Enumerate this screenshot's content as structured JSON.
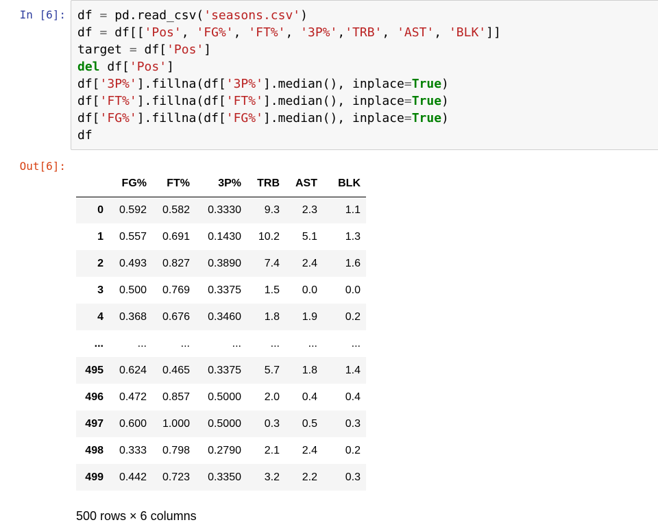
{
  "cell": {
    "in_prompt": "In [6]:",
    "out_prompt": "Out[6]:",
    "code_lines": [
      [
        {
          "t": "df "
        },
        {
          "t": "=",
          "c": "o"
        },
        {
          "t": " pd.read_csv("
        },
        {
          "t": "'seasons.csv'",
          "c": "s"
        },
        {
          "t": ")"
        }
      ],
      [
        {
          "t": "df "
        },
        {
          "t": "=",
          "c": "o"
        },
        {
          "t": " df[["
        },
        {
          "t": "'Pos'",
          "c": "s"
        },
        {
          "t": ", "
        },
        {
          "t": "'FG%'",
          "c": "s"
        },
        {
          "t": ", "
        },
        {
          "t": "'FT%'",
          "c": "s"
        },
        {
          "t": ", "
        },
        {
          "t": "'3P%'",
          "c": "s"
        },
        {
          "t": ","
        },
        {
          "t": "'TRB'",
          "c": "s"
        },
        {
          "t": ", "
        },
        {
          "t": "'AST'",
          "c": "s"
        },
        {
          "t": ", "
        },
        {
          "t": "'BLK'",
          "c": "s"
        },
        {
          "t": "]]"
        }
      ],
      [
        {
          "t": "target "
        },
        {
          "t": "=",
          "c": "o"
        },
        {
          "t": " df["
        },
        {
          "t": "'Pos'",
          "c": "s"
        },
        {
          "t": "]"
        }
      ],
      [
        {
          "t": "del",
          "c": "k"
        },
        {
          "t": " df["
        },
        {
          "t": "'Pos'",
          "c": "s"
        },
        {
          "t": "]"
        }
      ],
      [
        {
          "t": "df["
        },
        {
          "t": "'3P%'",
          "c": "s"
        },
        {
          "t": "].fillna(df["
        },
        {
          "t": "'3P%'",
          "c": "s"
        },
        {
          "t": "].median(), inplace"
        },
        {
          "t": "=",
          "c": "o"
        },
        {
          "t": "True",
          "c": "k"
        },
        {
          "t": ")"
        }
      ],
      [
        {
          "t": "df["
        },
        {
          "t": "'FT%'",
          "c": "s"
        },
        {
          "t": "].fillna(df["
        },
        {
          "t": "'FT%'",
          "c": "s"
        },
        {
          "t": "].median(), inplace"
        },
        {
          "t": "=",
          "c": "o"
        },
        {
          "t": "True",
          "c": "k"
        },
        {
          "t": ")"
        }
      ],
      [
        {
          "t": "df["
        },
        {
          "t": "'FG%'",
          "c": "s"
        },
        {
          "t": "].fillna(df["
        },
        {
          "t": "'FG%'",
          "c": "s"
        },
        {
          "t": "].median(), inplace"
        },
        {
          "t": "=",
          "c": "o"
        },
        {
          "t": "True",
          "c": "k"
        },
        {
          "t": ")"
        }
      ],
      [
        {
          "t": "df"
        }
      ]
    ]
  },
  "dataframe": {
    "columns": [
      "FG%",
      "FT%",
      "3P%",
      "TRB",
      "AST",
      "BLK"
    ],
    "rows": [
      {
        "index": "0",
        "values": [
          "0.592",
          "0.582",
          "0.3330",
          "9.3",
          "2.3",
          "1.1"
        ]
      },
      {
        "index": "1",
        "values": [
          "0.557",
          "0.691",
          "0.1430",
          "10.2",
          "5.1",
          "1.3"
        ]
      },
      {
        "index": "2",
        "values": [
          "0.493",
          "0.827",
          "0.3890",
          "7.4",
          "2.4",
          "1.6"
        ]
      },
      {
        "index": "3",
        "values": [
          "0.500",
          "0.769",
          "0.3375",
          "1.5",
          "0.0",
          "0.0"
        ]
      },
      {
        "index": "4",
        "values": [
          "0.368",
          "0.676",
          "0.3460",
          "1.8",
          "1.9",
          "0.2"
        ]
      },
      {
        "index": "...",
        "values": [
          "...",
          "...",
          "...",
          "...",
          "...",
          "..."
        ]
      },
      {
        "index": "495",
        "values": [
          "0.624",
          "0.465",
          "0.3375",
          "5.7",
          "1.8",
          "1.4"
        ]
      },
      {
        "index": "496",
        "values": [
          "0.472",
          "0.857",
          "0.5000",
          "2.0",
          "0.4",
          "0.4"
        ]
      },
      {
        "index": "497",
        "values": [
          "0.600",
          "1.000",
          "0.5000",
          "0.3",
          "0.5",
          "0.3"
        ]
      },
      {
        "index": "498",
        "values": [
          "0.333",
          "0.798",
          "0.2790",
          "2.1",
          "2.4",
          "0.2"
        ]
      },
      {
        "index": "499",
        "values": [
          "0.442",
          "0.723",
          "0.3350",
          "3.2",
          "2.2",
          "0.3"
        ]
      }
    ],
    "shape_text": "500 rows × 6 columns"
  },
  "colors": {
    "in_prompt": "#303f9f",
    "out_prompt": "#d84315",
    "string": "#ba2121",
    "keyword": "#008000",
    "operator": "#666666",
    "cell_background": "#f7f7f7",
    "cell_border": "#cfcfcf",
    "stripe": "#f5f5f5"
  }
}
